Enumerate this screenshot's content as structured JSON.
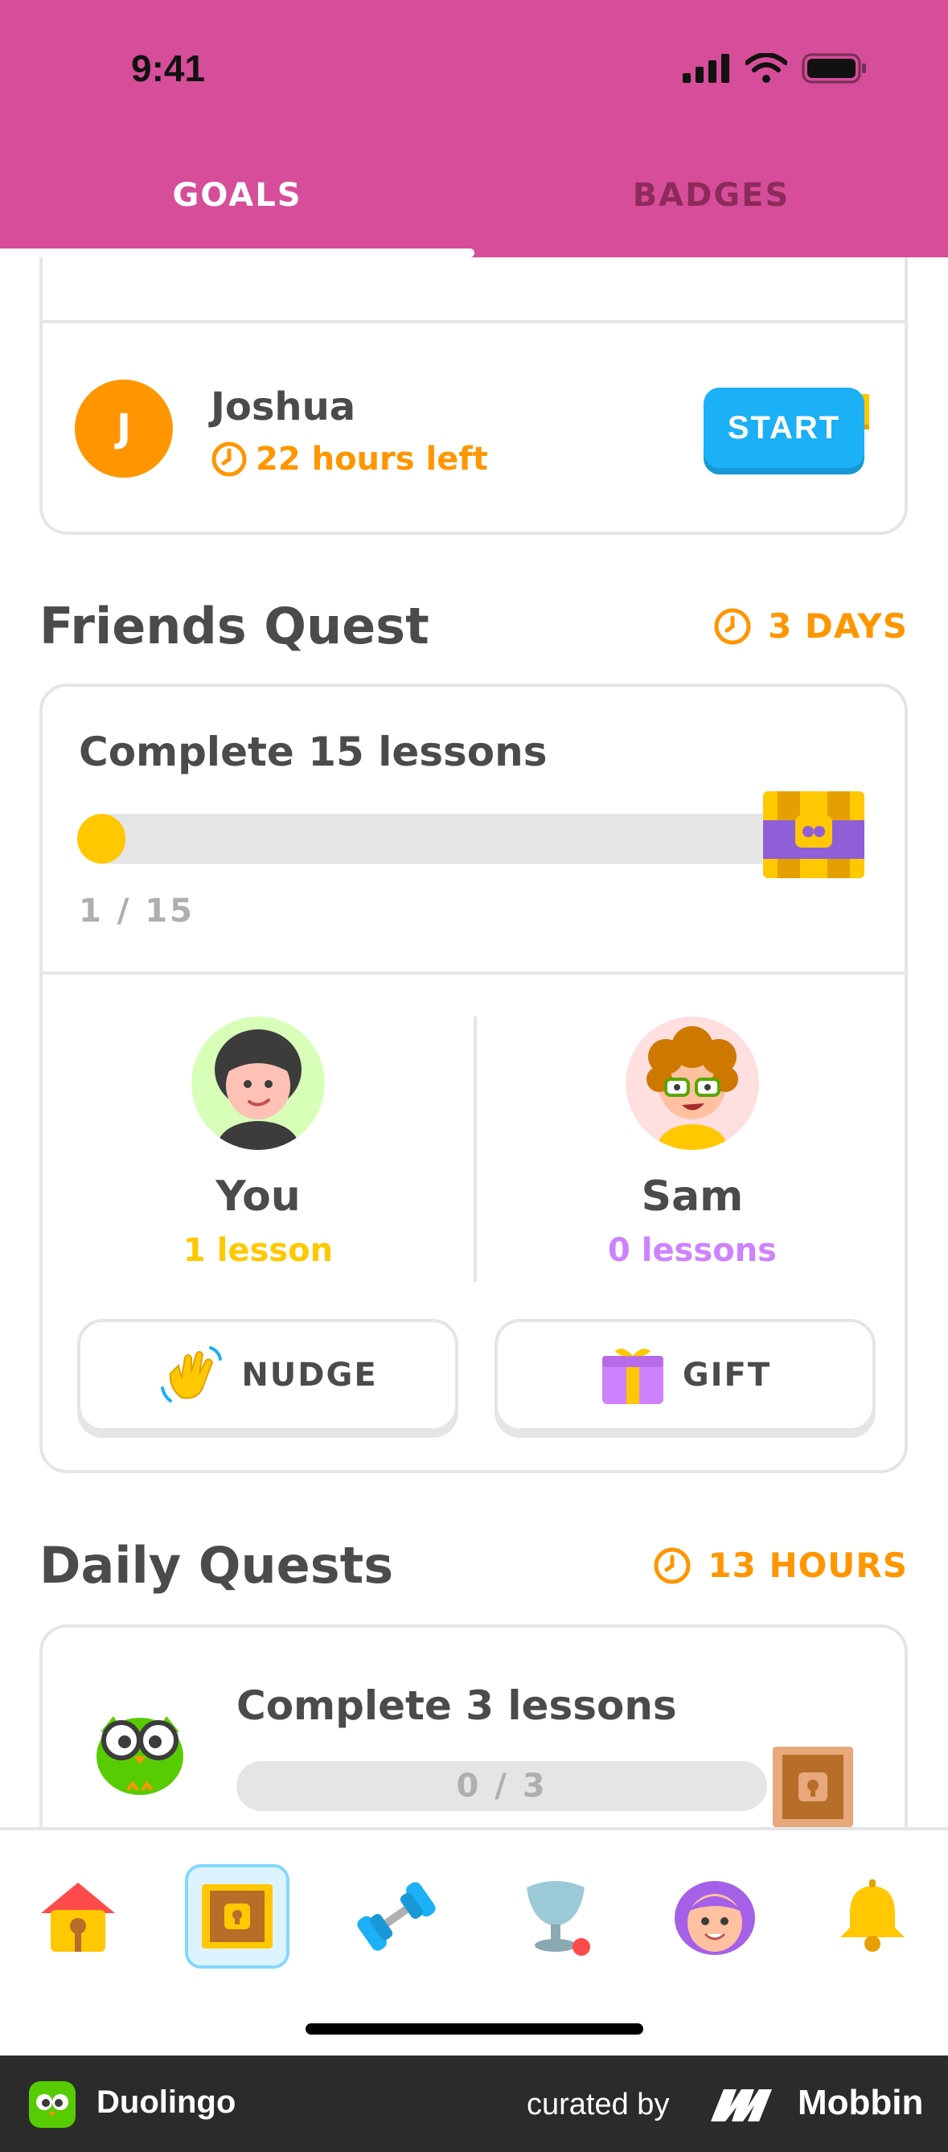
{
  "status_bar": {
    "time": "9:41"
  },
  "tabs": {
    "goals": "GOALS",
    "badges": "BADGES"
  },
  "friend_row": {
    "initial": "J",
    "name": "Joshua",
    "time_left": "22 hours left",
    "start_label": "START"
  },
  "friends_quest": {
    "title": "Friends Quest",
    "timer": "3 DAYS",
    "task": "Complete 15 lessons",
    "progress_text": "1 / 15",
    "progress": {
      "current": 1,
      "total": 15
    },
    "participants": [
      {
        "name": "You",
        "lessons": "1 lesson",
        "color": "#ffc800"
      },
      {
        "name": "Sam",
        "lessons": "0 lessons",
        "color": "#ce82ff"
      }
    ],
    "nudge_label": "NUDGE",
    "gift_label": "GIFT"
  },
  "daily_quests": {
    "title": "Daily Quests",
    "timer": "13 HOURS",
    "task": "Complete 3 lessons",
    "progress_text": "0 / 3",
    "progress": {
      "current": 0,
      "total": 3
    }
  },
  "bottom_nav": {
    "items": [
      "home-icon",
      "quests-chest-icon",
      "practice-dumbbell-icon",
      "leagues-trophy-icon",
      "profile-avatar-icon",
      "notifications-bell-icon"
    ],
    "active": "quests-chest-icon"
  },
  "footer": {
    "app_name": "Duolingo",
    "curated_by": "curated by",
    "brand": "Mobbin"
  },
  "colors": {
    "header": "#d64d99",
    "accent_orange": "#ff9600",
    "accent_blue": "#1cb0f6",
    "progress_yellow": "#ffc800"
  }
}
